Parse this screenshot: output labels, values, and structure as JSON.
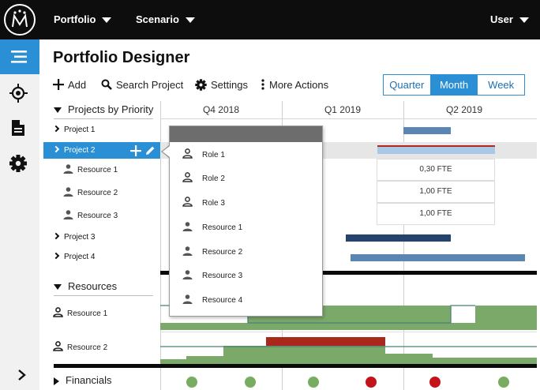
{
  "topbar": {
    "menus": [
      {
        "label": "Portfolio"
      },
      {
        "label": "Scenario"
      }
    ],
    "user_label": "User"
  },
  "sidebar": {
    "items": [
      {
        "icon": "list-icon",
        "active": true
      },
      {
        "icon": "target-icon",
        "active": false
      },
      {
        "icon": "document-icon",
        "active": false
      },
      {
        "icon": "gear-icon",
        "active": false
      }
    ],
    "expand_icon": "chevron-right-icon"
  },
  "page": {
    "title": "Portfolio Designer"
  },
  "toolbar": {
    "add_label": "Add",
    "search_label": "Search Project",
    "settings_label": "Settings",
    "more_label": "More Actions",
    "views": [
      {
        "label": "Quarter",
        "active": false
      },
      {
        "label": "Month",
        "active": true
      },
      {
        "label": "Week",
        "active": false
      }
    ]
  },
  "timeline": {
    "quarters": [
      "Q4 2018",
      "Q1 2019",
      "Q2 2019"
    ]
  },
  "projects": {
    "section_label": "Projects by Priority",
    "rows": [
      {
        "label": "Project 1"
      },
      {
        "label": "Project 2"
      },
      {
        "label": "Resource 1"
      },
      {
        "label": "Resource 2"
      },
      {
        "label": "Resource 3"
      },
      {
        "label": "Project 3"
      },
      {
        "label": "Project 4"
      }
    ],
    "fte_values": [
      "0,30 FTE",
      "1,00 FTE",
      "1,00 FTE"
    ]
  },
  "resources": {
    "section_label": "Resources",
    "rows": [
      {
        "label": "Resource 1"
      },
      {
        "label": "Resource 2"
      }
    ]
  },
  "financials": {
    "section_label": "Financials",
    "status_dots": [
      "green",
      "green",
      "green",
      "red",
      "red",
      "green"
    ]
  },
  "popup": {
    "items": [
      {
        "label": "Role 1",
        "icon": "person-outline-icon"
      },
      {
        "label": "Role 2",
        "icon": "person-outline-icon"
      },
      {
        "label": "Role 3",
        "icon": "person-outline-icon"
      },
      {
        "label": "Resource 1",
        "icon": "person-icon"
      },
      {
        "label": "Resource 2",
        "icon": "person-icon"
      },
      {
        "label": "Resource 3",
        "icon": "person-icon"
      },
      {
        "label": "Resource 4",
        "icon": "person-icon"
      }
    ]
  },
  "colors": {
    "accent": "#2b8fd6",
    "bar_light": "#5b85b3",
    "bar_dark": "#24446d",
    "alloc_green": "#7ba96a",
    "over_red": "#a8281c",
    "dot_green": "#78ac63",
    "dot_red": "#c4141a"
  }
}
